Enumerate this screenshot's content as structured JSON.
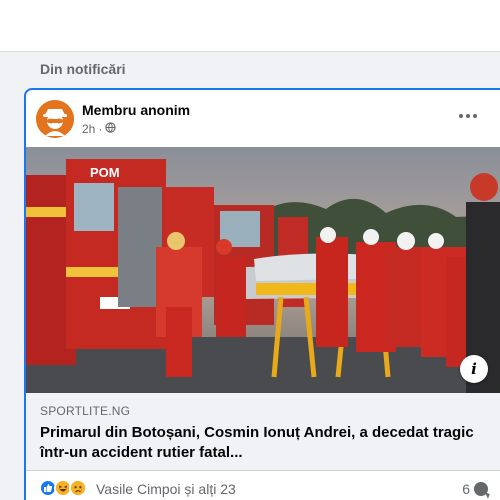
{
  "section": {
    "label": "Din notificări"
  },
  "post": {
    "author": "Membru anonim",
    "time": "2h",
    "separator": "·",
    "privacy_icon": "globe-icon",
    "more_icon": "more-horizontal-icon",
    "avatar_icon": "anonymous-member-icon",
    "image": {
      "description_icon": "info-icon",
      "info_label": "i",
      "van_label": "POM"
    },
    "link": {
      "domain": "SPORTLITE.NG",
      "title": "Primarul din Botoșani, Cosmin Ionuț Andrei, a decedat tragic într-un accident rutier fatal..."
    },
    "reactions": {
      "icons": [
        "like-icon",
        "haha-icon",
        "sad-icon"
      ],
      "names": "Vasile Cimpoi și alți 23",
      "comment_count": "6",
      "comment_icon": "comment-icon"
    }
  },
  "colors": {
    "accent": "#1877f2",
    "avatar": "#e4731d",
    "like": "#1877f2",
    "haha": "#f7b125",
    "muted": "#65676b"
  }
}
